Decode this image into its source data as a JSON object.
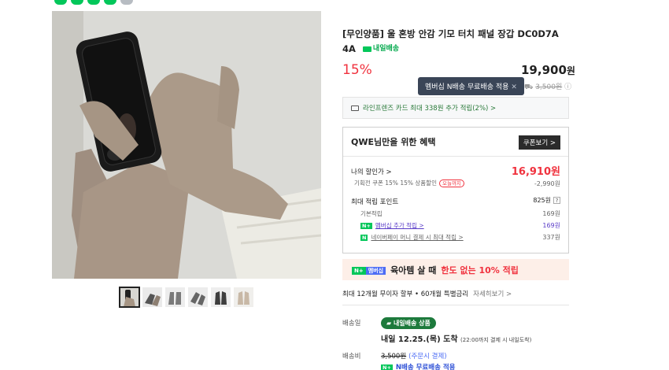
{
  "product": {
    "title": "[무인양품] 울 혼방 안감 기모 터치 패널 장갑 DC0D7A 4A",
    "naedil_label": "내일배송",
    "discount": "15%",
    "price": "19,900",
    "price_unit": "원",
    "tooltip": "멤버십 N배송 무료배송 적용",
    "original_label": "3,500원",
    "card_promo": "라인프렌즈 카드 최대 338원 추가 적립(2%) >"
  },
  "benefit": {
    "heading": "QWE님만을 위한 혜택",
    "coupon_button": "쿠폰보기 >",
    "my_price_label": "나의 할인가 >",
    "my_price": "16,910원",
    "coupon_line": "기획전 쿠폰 15% 15% 상품할인",
    "coupon_badge": "오늘까지",
    "coupon_value": "-2,990원",
    "points_label": "최대 적립 포인트",
    "points_value": "825원",
    "points_help": "?",
    "basic_label": "기본적립",
    "basic_value": "169원",
    "member_label": "멤버십 추가 적립 >",
    "member_value": "169원",
    "npay_label": "네이버페이 머니 결제 시 최대 적립 >",
    "npay_value": "337원"
  },
  "promo": {
    "tag": "멤버십",
    "text_a": "육아템 살 때",
    "text_b": "한도 없는 10% 적립"
  },
  "installment": {
    "text": "최대 12개월 무이자 할부 • 60개월 특별금리",
    "more": "자세히보기 >"
  },
  "shipping": {
    "label": "배송일",
    "badge": "내일배송 상품",
    "date": "내일 12.25.(목) 도착",
    "note": "(22:00까지 결제 시 내일도착)",
    "fee_label": "배송비",
    "fee": "3,500원",
    "fee_cond": "(주문시 결제)",
    "free": "N배송 무료배송 적용"
  },
  "colors": {
    "accent_red": "#f0323e",
    "naver_green": "#03c75a",
    "promo_bg": "#fdefe8"
  }
}
